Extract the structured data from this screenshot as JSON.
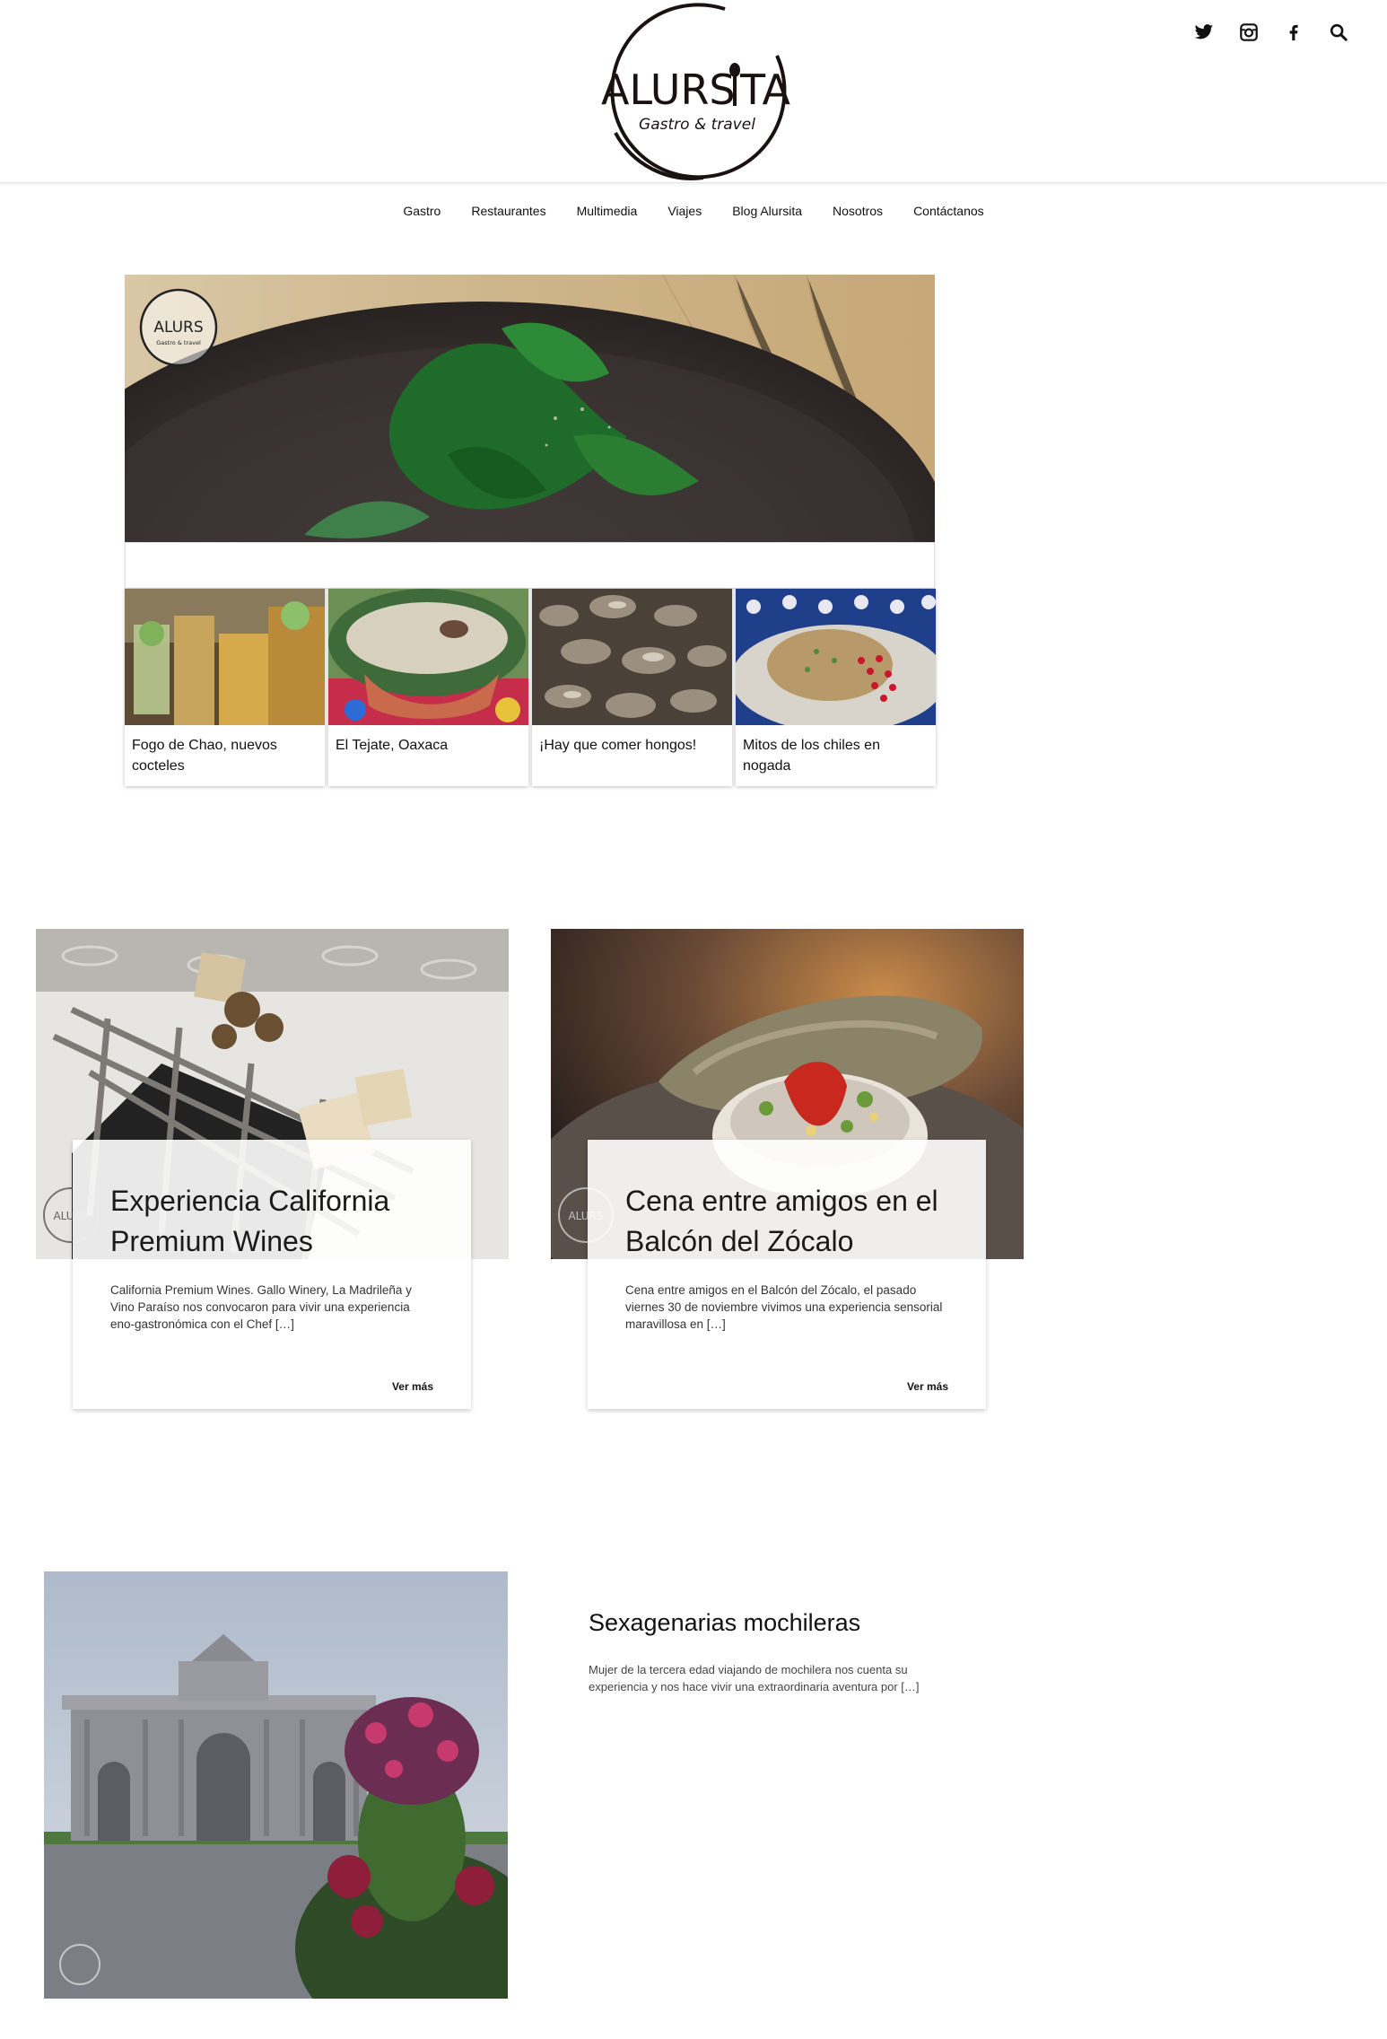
{
  "brand": {
    "name": "ALURS",
    "name_tail": "TA",
    "tagline": "Gastro & travel"
  },
  "social": [
    "twitter-icon",
    "instagram-icon",
    "facebook-icon",
    "search-icon"
  ],
  "nav": {
    "items": [
      "Gastro",
      "Restaurantes",
      "Multimedia",
      "Viajes",
      "Blog Alursita",
      "Nosotros",
      "Contáctanos"
    ]
  },
  "slider": {
    "thumbs": [
      {
        "caption": "Fogo de Chao, nuevos cocteles"
      },
      {
        "caption": "El Tejate, Oaxaca"
      },
      {
        "caption": "¡Hay que comer hongos!"
      },
      {
        "caption": "Mitos de los chiles en nogada"
      }
    ]
  },
  "featured": [
    {
      "title": "Experiencia California Premium Wines",
      "excerpt": "California Premium Wines. Gallo Winery, La Madrileña y Vino Paraíso nos convocaron para vivir una experiencia eno-gastronómica con el Chef […]",
      "more": "Ver más"
    },
    {
      "title": "Cena entre amigos en el Balcón del Zócalo",
      "excerpt": "Cena entre amigos en el Balcón del Zócalo, el pasado viernes 30 de noviembre vivimos una experiencia sensorial maravillosa en […]",
      "more": "Ver más"
    }
  ],
  "post3": {
    "title": "Sexagenarias mochileras",
    "excerpt": "Mujer de la tercera edad viajando de mochilera nos cuenta su experiencia y nos hace vivir una extraordinaria aventura por […]"
  }
}
